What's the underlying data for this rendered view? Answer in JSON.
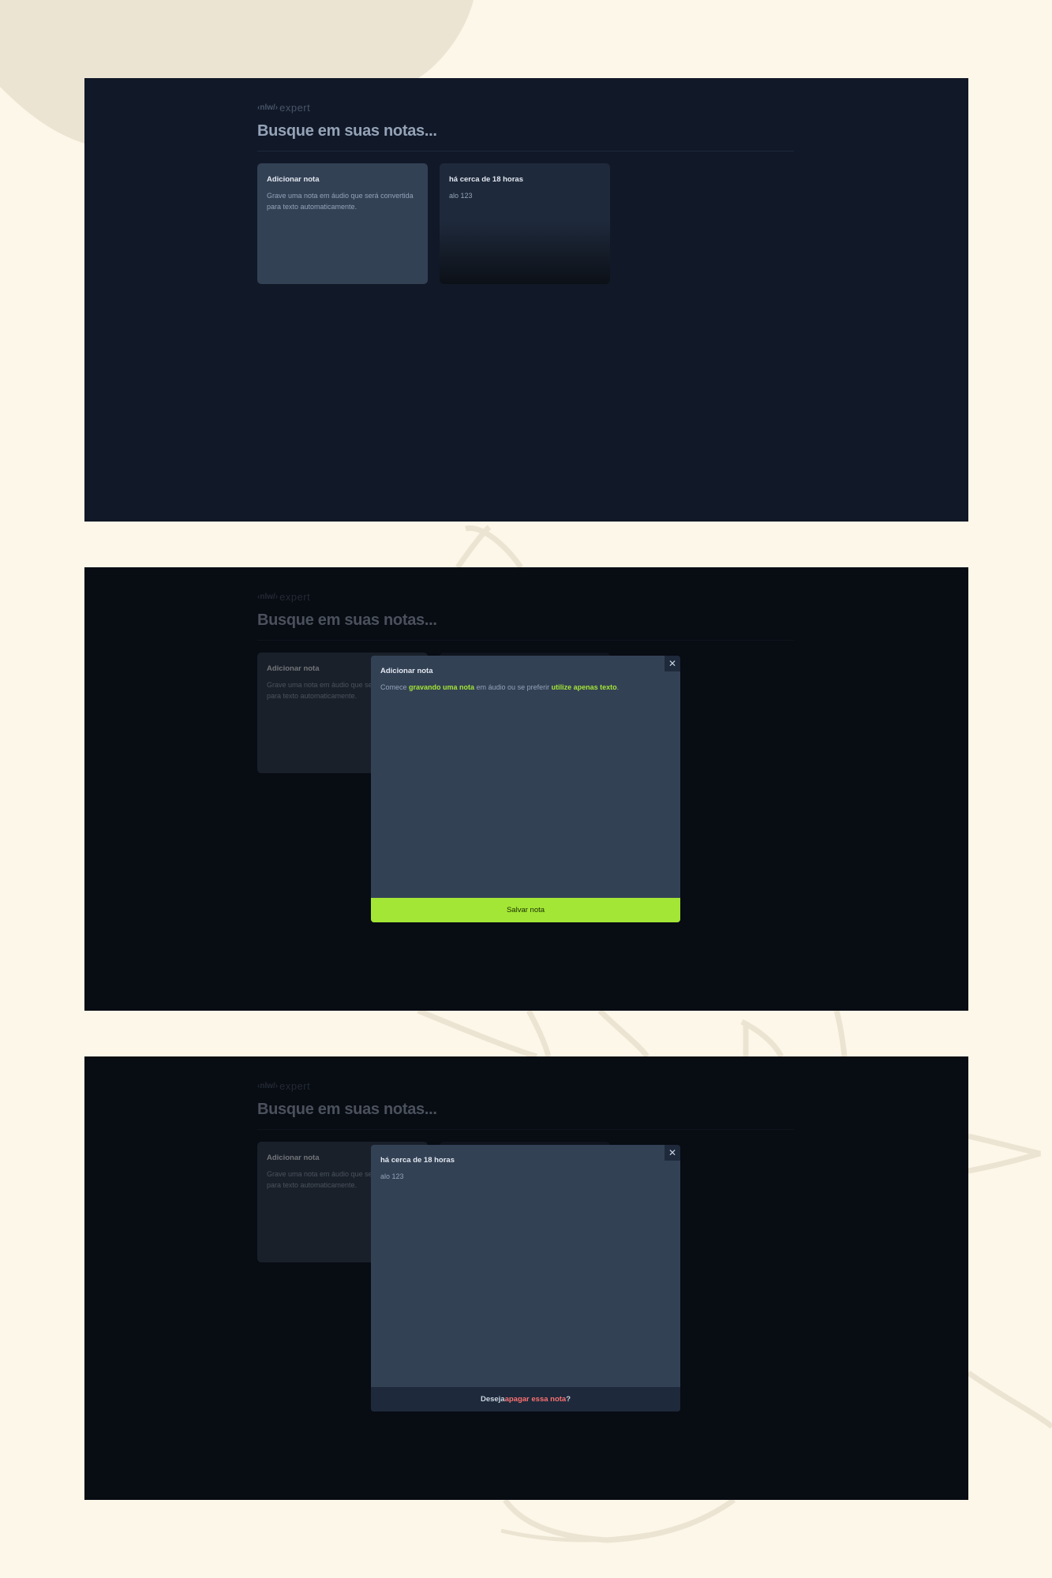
{
  "app": {
    "logo_tag": "‹nlw/›",
    "logo_text": "expert",
    "search_placeholder": "Busque em suas notas..."
  },
  "cards": {
    "add": {
      "title": "Adicionar nota",
      "description": "Grave uma nota em áudio que será convertida para texto automaticamente."
    },
    "note": {
      "date": "há cerca de 18 horas",
      "content": "alo 123"
    }
  },
  "new_note_modal": {
    "title": "Adicionar nota",
    "text_prefix": "Comece ",
    "link_record": "gravando uma nota",
    "text_middle": " em áudio ou se preferir ",
    "link_text": "utilize apenas texto",
    "text_suffix": ".",
    "save_label": "Salvar nota",
    "close_icon": "x-icon"
  },
  "note_modal": {
    "date": "há cerca de 18 horas",
    "content": "alo 123",
    "delete_prefix": "Deseja ",
    "delete_link": "apagar essa nota",
    "delete_suffix": "?",
    "close_icon": "x-icon"
  },
  "colors": {
    "page_bg": "#fdf7e9",
    "app_bg": "#111827",
    "card_add": "#334155",
    "card_note": "#1e293b",
    "accent_lime": "#a3e635",
    "danger_red": "#f87171"
  }
}
